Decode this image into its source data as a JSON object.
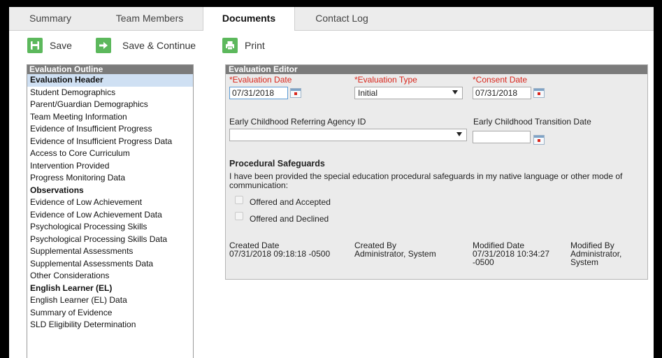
{
  "tabs": [
    {
      "label": "Summary"
    },
    {
      "label": "Team Members"
    },
    {
      "label": "Documents",
      "active": true
    },
    {
      "label": "Contact Log"
    }
  ],
  "toolbar": {
    "save_label": "Save",
    "save_continue_label": "Save & Continue",
    "print_label": "Print",
    "icon_color": "#5cb85c"
  },
  "outline": {
    "title": "Evaluation Outline",
    "items": [
      {
        "label": "Evaluation Header",
        "style": "selected"
      },
      {
        "label": "Student Demographics"
      },
      {
        "label": "Parent/Guardian Demographics"
      },
      {
        "label": "Team Meeting Information"
      },
      {
        "label": "Evidence of Insufficient Progress"
      },
      {
        "label": "Evidence of Insufficient Progress Data"
      },
      {
        "label": "Access to Core Curriculum"
      },
      {
        "label": "Intervention Provided"
      },
      {
        "label": "Progress Monitoring Data"
      },
      {
        "label": "Observations",
        "style": "bold"
      },
      {
        "label": "Evidence of Low Achievement"
      },
      {
        "label": "Evidence of Low Achievement Data"
      },
      {
        "label": "Psychological Processing Skills"
      },
      {
        "label": "Psychological Processing Skills Data"
      },
      {
        "label": "Supplemental Assessments"
      },
      {
        "label": "Supplemental Assessments Data"
      },
      {
        "label": "Other Considerations"
      },
      {
        "label": "English Learner (EL)",
        "style": "bold"
      },
      {
        "label": "English Learner (EL) Data"
      },
      {
        "label": "Summary of Evidence"
      },
      {
        "label": "SLD Eligibility Determination"
      }
    ]
  },
  "editor": {
    "title": "Evaluation Editor",
    "evaluation_date_label": "*Evaluation Date",
    "evaluation_date_value": "07/31/2018",
    "evaluation_type_label": "*Evaluation Type",
    "evaluation_type_value": "Initial",
    "consent_date_label": "*Consent Date",
    "consent_date_value": "07/31/2018",
    "referring_agency_label": "Early Childhood Referring Agency ID",
    "referring_agency_value": "",
    "transition_date_label": "Early Childhood Transition Date",
    "transition_date_value": "",
    "safeguards_heading": "Procedural Safeguards",
    "safeguards_text": "I have been provided the special education procedural safeguards in my native language or other mode of communication:",
    "option_accepted": "Offered and Accepted",
    "option_declined": "Offered and Declined",
    "created_date_label": "Created Date",
    "created_date_value": "07/31/2018 09:18:18 -0500",
    "created_by_label": "Created By",
    "created_by_value": "Administrator, System",
    "modified_date_label": "Modified Date",
    "modified_date_value": "07/31/2018 10:34:27 -0500",
    "modified_by_label": "Modified By",
    "modified_by_value": "Administrator, System",
    "required_color": "#d9261c"
  }
}
